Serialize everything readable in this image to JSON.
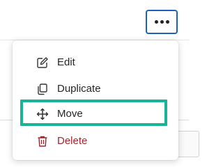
{
  "more_button": {
    "icon": "more-horizontal-icon",
    "border_color": "#1f5fbf"
  },
  "menu": {
    "items": [
      {
        "label": "Edit",
        "icon": "edit-icon"
      },
      {
        "label": "Duplicate",
        "icon": "duplicate-icon"
      },
      {
        "label": "Move",
        "icon": "move-icon",
        "highlighted": true
      },
      {
        "label": "Delete",
        "icon": "trash-icon",
        "color": "#a4262c"
      }
    ],
    "highlight_color": "#17b497"
  }
}
